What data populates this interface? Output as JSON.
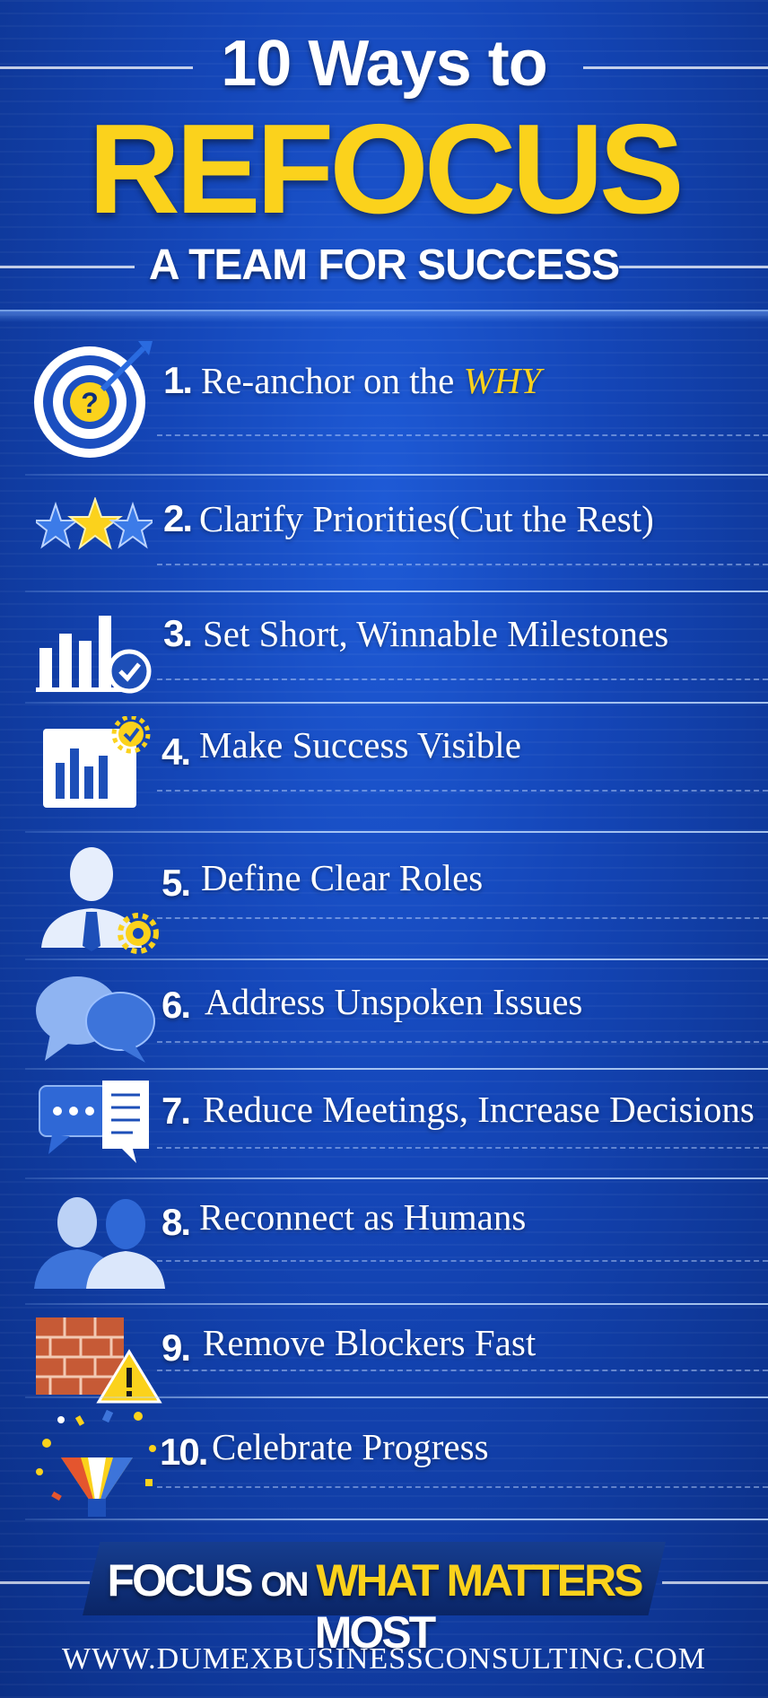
{
  "header": {
    "title_top": "10 Ways to",
    "title_main": "REFOCUS",
    "title_sub": "A TEAM FOR SUCCESS"
  },
  "items": [
    {
      "number": "1.",
      "text": "Re-anchor on the",
      "emphasis": "WHY",
      "icon": "target-question-icon"
    },
    {
      "number": "2.",
      "text": "Clarify Priorities(Cut the Rest)",
      "icon": "stars-icon"
    },
    {
      "number": "3.",
      "text": "Set Short, Winnable Milestones",
      "icon": "bar-chart-check-icon"
    },
    {
      "number": "4.",
      "text": "Make Success Visible",
      "icon": "dashboard-gear-icon"
    },
    {
      "number": "5.",
      "text": "Define Clear Roles",
      "icon": "person-gear-icon"
    },
    {
      "number": "6.",
      "text": "Address Unspoken Issues",
      "icon": "speech-bubbles-icon"
    },
    {
      "number": "7.",
      "text": "Reduce Meetings, Increase Decisions",
      "icon": "chat-document-icon"
    },
    {
      "number": "8.",
      "text": "Reconnect as Humans",
      "icon": "two-people-icon"
    },
    {
      "number": "9.",
      "text": "Remove Blockers Fast",
      "icon": "brick-wall-warning-icon"
    },
    {
      "number": "10.",
      "text": "Celebrate Progress",
      "icon": "confetti-icon"
    }
  ],
  "footer": {
    "part1": "FOCUS",
    "part2": "ON",
    "part3": "WHAT MATTERS",
    "part4": "MOST",
    "url": "WWW.DUMEXBUSINESSCONSULTING.COM"
  },
  "colors": {
    "background": "#1446b8",
    "accent_yellow": "#fbd21c",
    "text": "#ffffff"
  }
}
